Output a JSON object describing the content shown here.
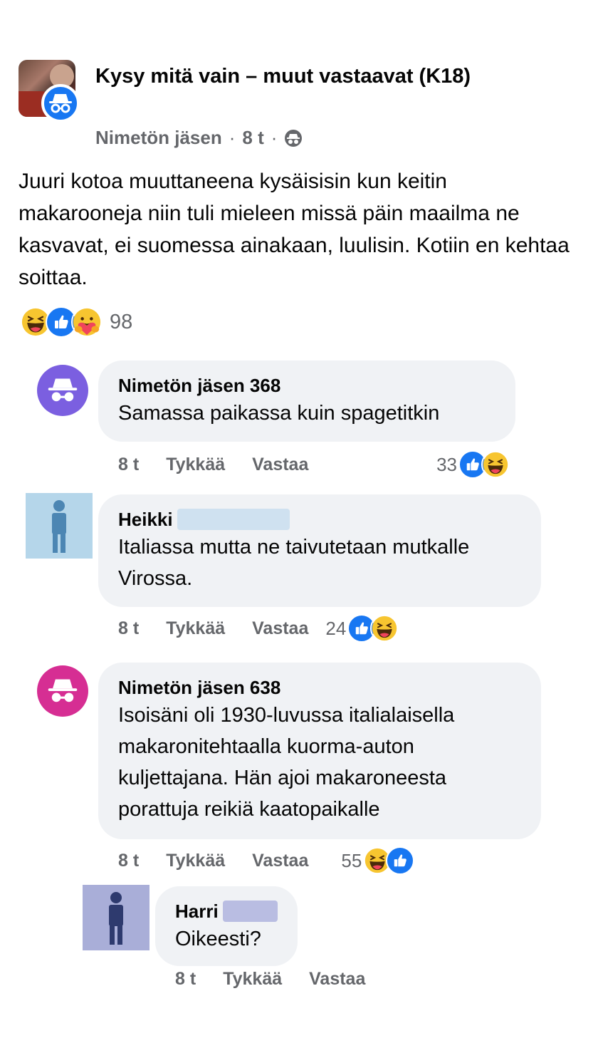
{
  "post": {
    "group_name": "Kysy mitä vain – muut vastaavat (K18)",
    "author": "Nimetön jäsen",
    "time": "8 t",
    "separator": "·",
    "text": "Juuri kotoa muuttaneena kysäisisin kun keitin makarooneja niin tuli mieleen missä päin maailma ne kasvavat, ei suomessa ainakaan, luulisin. Kotiin en kehtaa soittaa.",
    "reaction_icons": [
      "haha-icon",
      "like-icon",
      "care-icon"
    ],
    "reaction_count": "98"
  },
  "actions": {
    "like_label": "Tykkää",
    "reply_label": "Vastaa"
  },
  "comments": [
    {
      "name": "Nimetön jäsen 368",
      "text": "Samassa paikassa kuin spagetitkin",
      "time": "8 t",
      "reaction_count": "33",
      "reaction_icons": [
        "like-icon",
        "haha-icon"
      ],
      "avatar_color": "#7b5fe0"
    },
    {
      "name": "Heikki",
      "text": "Italiassa mutta ne taivutetaan mutkalle Virossa.",
      "time": "8 t",
      "reaction_count": "24",
      "reaction_icons": [
        "like-icon",
        "haha-icon"
      ],
      "avatar_color": "#b5d6ea"
    },
    {
      "name": "Nimetön jäsen 638",
      "text": "Isoisäni oli 1930-luvussa italialaisella makaronitehtaalla kuorma-auton kuljettajana. Hän ajoi makaroneesta porattuja reikiä kaatopaikalle",
      "time": "8 t",
      "reaction_count": "55",
      "reaction_icons": [
        "haha-icon",
        "like-icon"
      ],
      "avatar_color": "#d62e93"
    },
    {
      "name": "Harri",
      "text": "Oikeesti?",
      "time": "8 t",
      "avatar_color": "#a9aed8"
    }
  ],
  "colors": {
    "like_blue": "#1877f2",
    "haha_yellow": "#f7c530",
    "secondary_text": "#65676b",
    "bubble_bg": "#f0f2f5"
  }
}
